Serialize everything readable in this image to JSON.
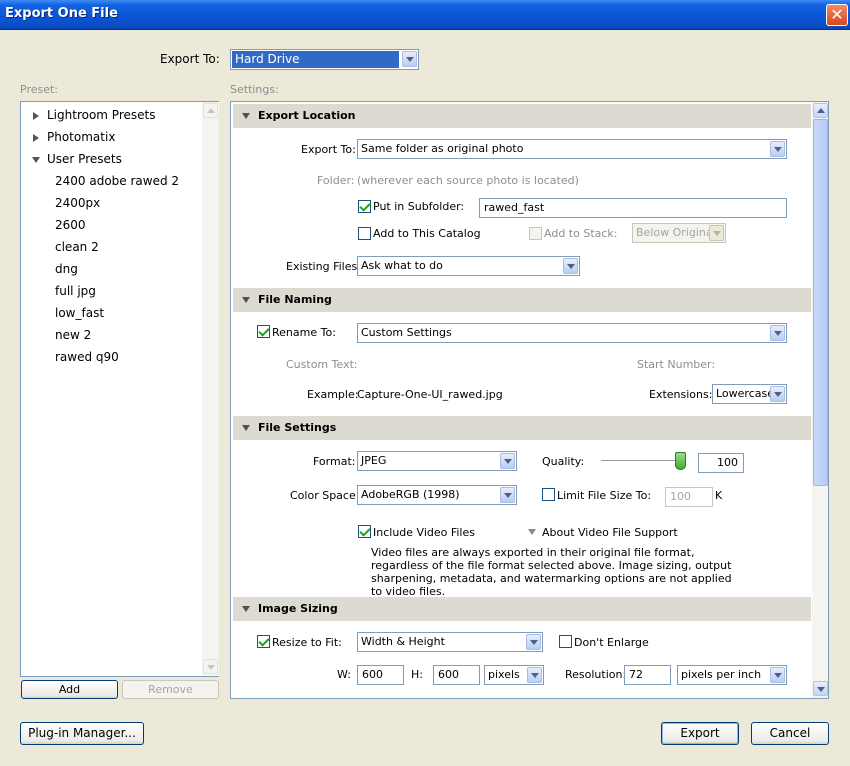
{
  "window": {
    "title": "Export One File",
    "close_glyph": "✕"
  },
  "export_to": {
    "label": "Export To:",
    "value": "Hard Drive"
  },
  "preset": {
    "header": "Preset:",
    "tree": [
      {
        "label": "Lightroom Presets",
        "expanded": false
      },
      {
        "label": "Photomatix",
        "expanded": false
      },
      {
        "label": "User Presets",
        "expanded": true
      }
    ],
    "user_presets": [
      "2400 adobe rawed 2",
      "2400px",
      "2600",
      "clean 2",
      "dng",
      "full jpg",
      "low_fast",
      "new 2",
      "rawed q90"
    ],
    "add_button": "Add",
    "remove_button": "Remove"
  },
  "settings": {
    "header": "Settings:",
    "export_location": {
      "title": "Export Location",
      "export_to_label": "Export To:",
      "export_to_value": "Same folder as original photo",
      "folder_label": "Folder:",
      "folder_value": "(wherever each source photo is located)",
      "subfolder_label": "Put in Subfolder:",
      "subfolder_checked": true,
      "subfolder_value": "rawed_fast",
      "add_catalog_label": "Add to This Catalog",
      "add_catalog_checked": false,
      "add_stack_label": "Add to Stack:",
      "add_stack_value": "Below Original",
      "existing_label": "Existing Files:",
      "existing_value": "Ask what to do"
    },
    "file_naming": {
      "title": "File Naming",
      "rename_label": "Rename To:",
      "rename_checked": true,
      "rename_value": "Custom Settings",
      "custom_text_label": "Custom Text:",
      "start_number_label": "Start Number:",
      "example_label": "Example:",
      "example_value": "Capture-One-UI_rawed.jpg",
      "extensions_label": "Extensions:",
      "extensions_value": "Lowercase"
    },
    "file_settings": {
      "title": "File Settings",
      "format_label": "Format:",
      "format_value": "JPEG",
      "quality_label": "Quality:",
      "quality_value": "100",
      "quality_level": 1.0,
      "colorspace_label": "Color Space:",
      "colorspace_value": "AdobeRGB (1998)",
      "limit_label": "Limit File Size To:",
      "limit_value": "100",
      "limit_unit": "K",
      "video_label": "Include Video Files",
      "video_checked": true,
      "about_video_label": "About Video File Support",
      "video_note": "Video files are always exported in their original file format, regardless of the file format selected above. Image sizing, output sharpening, metadata, and watermarking options are not applied to video files."
    },
    "image_sizing": {
      "title": "Image Sizing",
      "resize_label": "Resize to Fit:",
      "resize_checked": true,
      "resize_value": "Width & Height",
      "dont_enlarge_label": "Don't Enlarge",
      "w_label": "W:",
      "w_value": "600",
      "h_label": "H:",
      "h_value": "600",
      "units_value": "pixels",
      "resolution_label": "Resolution:",
      "resolution_value": "72",
      "resolution_units": "pixels per inch"
    }
  },
  "footer": {
    "plugin_manager": "Plug-in Manager...",
    "export": "Export",
    "cancel": "Cancel"
  }
}
